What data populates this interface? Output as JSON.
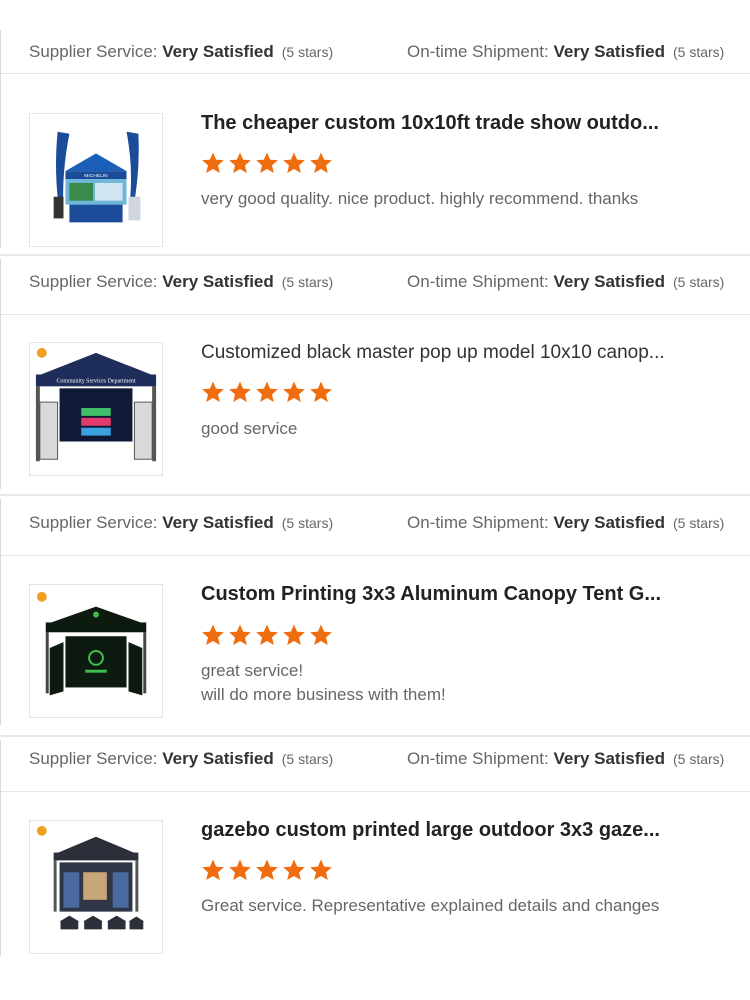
{
  "colors": {
    "star": "#f06d0f",
    "divider": "#e8e8ee",
    "text_muted": "#666666",
    "text_strong": "#222222"
  },
  "reviews": [
    {
      "supplier_label": "Supplier Service:",
      "supplier_value": "Very Satisfied",
      "supplier_stars": "(5 stars)",
      "shipment_label": "On-time Shipment:",
      "shipment_value": "Very Satisfied",
      "shipment_stars": "(5 stars)",
      "product_title": "The cheaper custom 10x10ft trade show outdo...",
      "rating": 5,
      "text_lines": [
        "very good quality. nice product. highly recommend. thanks"
      ],
      "thumb_icon": "blue-trade-show-tent-image",
      "thumb_brand": "MICHELIN"
    },
    {
      "supplier_label": "Supplier Service:",
      "supplier_value": "Very Satisfied",
      "supplier_stars": "(5 stars)",
      "shipment_label": "On-time Shipment:",
      "shipment_value": "Very Satisfied",
      "shipment_stars": "(5 stars)",
      "product_title": "Customized black master pop up model 10x10 canop...",
      "rating": 5,
      "text_lines": [
        "good service"
      ],
      "thumb_icon": "navy-canopy-tent-image",
      "thumb_brand": "Community Services Department"
    },
    {
      "supplier_label": "Supplier Service:",
      "supplier_value": "Very Satisfied",
      "supplier_stars": "(5 stars)",
      "shipment_label": "On-time Shipment:",
      "shipment_value": "Very Satisfied",
      "shipment_stars": "(5 stars)",
      "product_title": "Custom Printing 3x3 Aluminum Canopy Tent G...",
      "rating": 5,
      "text_lines": [
        "great service!",
        "will do more business with them!"
      ],
      "thumb_icon": "black-green-canopy-tent-image",
      "thumb_brand": ""
    },
    {
      "supplier_label": "Supplier Service:",
      "supplier_value": "Very Satisfied",
      "supplier_stars": "(5 stars)",
      "shipment_label": "On-time Shipment:",
      "shipment_value": "Very Satisfied",
      "shipment_stars": "(5 stars)",
      "product_title": "gazebo custom printed large outdoor 3x3 gaze...",
      "rating": 5,
      "text_lines": [
        "Great service. Representative explained details and changes"
      ],
      "thumb_icon": "dark-gazebo-tent-image",
      "thumb_brand": ""
    }
  ]
}
